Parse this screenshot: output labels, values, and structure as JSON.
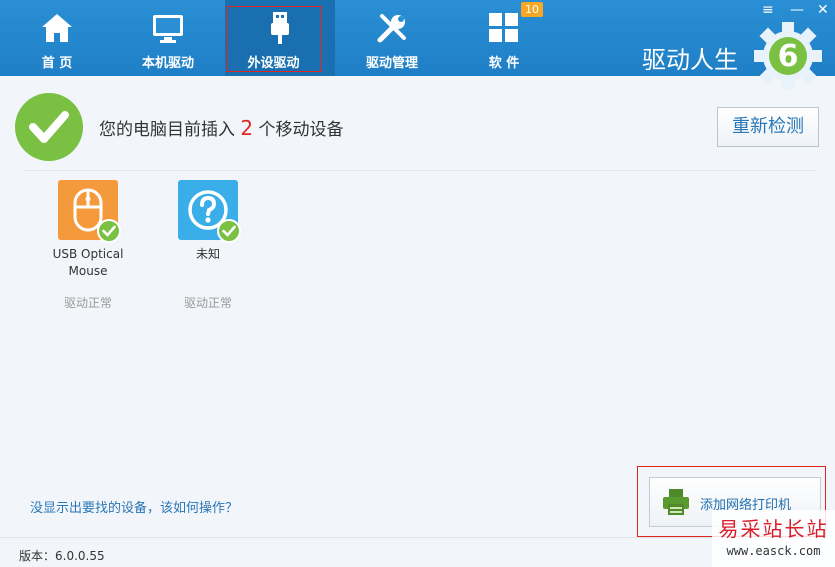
{
  "nav": {
    "items": [
      {
        "label": "首 页",
        "icon": "home-icon"
      },
      {
        "label": "本机驱动",
        "icon": "monitor-icon"
      },
      {
        "label": "外设驱动",
        "icon": "usb-icon",
        "active": true
      },
      {
        "label": "驱动管理",
        "icon": "tools-icon"
      },
      {
        "label": "软 件",
        "icon": "apps-grid-icon",
        "badge": "10"
      }
    ]
  },
  "window_controls": {
    "menu": "≡",
    "minimize": "—",
    "close": "✕"
  },
  "brand": {
    "name": "驱动人生",
    "logo_digit": "6"
  },
  "status": {
    "prefix": "您的电脑目前插入 ",
    "count": "2",
    "suffix": " 个移动设备"
  },
  "recheck_button": "重新检测",
  "devices": [
    {
      "name": "USB Optical Mouse",
      "status": "驱动正常",
      "icon": "mouse-icon",
      "color": "#f59a3c"
    },
    {
      "name": "未知",
      "status": "驱动正常",
      "icon": "question-icon",
      "color": "#39aee8"
    }
  ],
  "help_link": "没显示出要找的设备，该如何操作？",
  "add_printer_button": "添加网络打印机",
  "version": "版本：6.0.0.55",
  "watermark": {
    "title": "易采站长站",
    "url": "www.easck.com"
  },
  "colors": {
    "header": "#2a8fd4",
    "accent_red": "#e0261f",
    "check_green": "#7ac143"
  }
}
